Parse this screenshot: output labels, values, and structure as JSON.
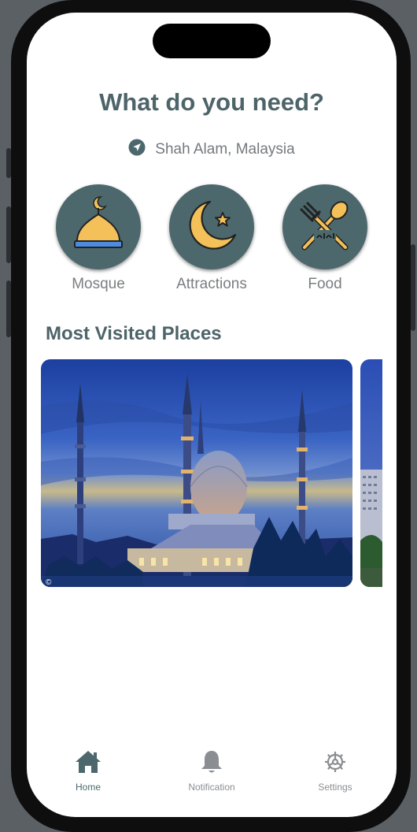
{
  "header": {
    "title": "What do you need?",
    "location": "Shah Alam, Malaysia"
  },
  "categories": [
    {
      "label": "Mosque",
      "icon": "mosque-dome-icon"
    },
    {
      "label": "Attractions",
      "icon": "crescent-star-icon"
    },
    {
      "label": "Food",
      "icon": "halal-fork-spoon-icon"
    }
  ],
  "most_visited": {
    "title": "Most Visited Places",
    "watermark": "©"
  },
  "tabs": [
    {
      "label": "Home",
      "icon": "home-icon",
      "active": true
    },
    {
      "label": "Notification",
      "icon": "bell-icon",
      "active": false
    },
    {
      "label": "Settings",
      "icon": "gear-icon",
      "active": false
    }
  ],
  "colors": {
    "accent": "#4c686c",
    "title": "#4d6469",
    "icon_gold": "#f3c05a",
    "muted_text": "#7a7e81"
  }
}
